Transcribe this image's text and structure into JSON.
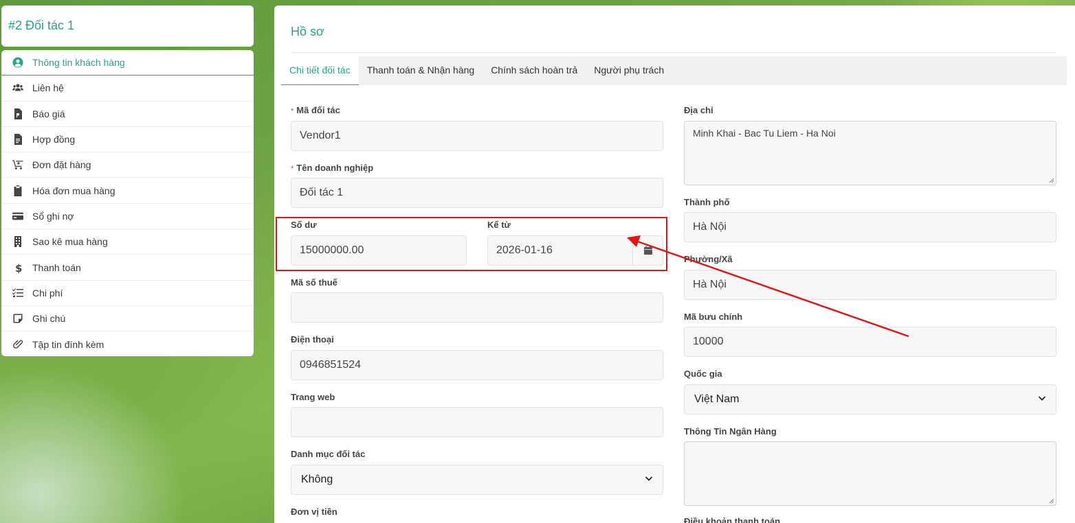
{
  "left": {
    "title": "#2 Đối tác 1",
    "menu": [
      {
        "label": "Thông tin khách hàng",
        "icon": "user-circle-icon",
        "active": true
      },
      {
        "label": "Liên hệ",
        "icon": "users-icon"
      },
      {
        "label": "Báo giá",
        "icon": "file-invoice-icon"
      },
      {
        "label": "Hợp đồng",
        "icon": "file-text-icon"
      },
      {
        "label": "Đơn đặt hàng",
        "icon": "cart-plus-icon"
      },
      {
        "label": "Hóa đơn mua hàng",
        "icon": "clipboard-icon"
      },
      {
        "label": "Sổ ghi nợ",
        "icon": "credit-card-icon"
      },
      {
        "label": "Sao kê mua hàng",
        "icon": "building-icon"
      },
      {
        "label": "Thanh toán",
        "icon": "dollar-icon"
      },
      {
        "label": "Chi phí",
        "icon": "checklist-icon"
      },
      {
        "label": "Ghi chú",
        "icon": "sticky-note-icon"
      },
      {
        "label": "Tập tin đính kèm",
        "icon": "paperclip-icon"
      }
    ]
  },
  "panel": {
    "title": "Hồ sơ",
    "tabs": [
      {
        "label": "Chi tiết đối tác",
        "active": true
      },
      {
        "label": "Thanh toán & Nhận hàng"
      },
      {
        "label": "Chính sách hoàn trả"
      },
      {
        "label": "Người phụ trách"
      }
    ]
  },
  "form": {
    "partner_code": {
      "label": "Mã đối tác",
      "required_mark": "*",
      "value": "Vendor1"
    },
    "company_name": {
      "label": "Tên doanh nghiệp",
      "required_mark": "*",
      "value": "Đối tác 1"
    },
    "balance": {
      "label": "Số dư",
      "value": "15000000.00"
    },
    "since": {
      "label": "Kể từ",
      "value": "2026-01-16"
    },
    "tax_code": {
      "label": "Mã số thuế",
      "value": ""
    },
    "phone": {
      "label": "Điện thoại",
      "value": "0946851524"
    },
    "website": {
      "label": "Trang web",
      "value": ""
    },
    "category": {
      "label": "Danh mục đối tác",
      "value": "Không"
    },
    "currency": {
      "label": "Đơn vị tiền"
    },
    "address": {
      "label": "Địa chỉ",
      "value": "Minh Khai - Bac Tu Liem - Ha Noi"
    },
    "city": {
      "label": "Thành phố",
      "value": "Hà Nội"
    },
    "ward": {
      "label": "Phường/Xã",
      "value": "Hà Nội"
    },
    "postal_code": {
      "label": "Mã bưu chính",
      "value": "10000"
    },
    "country": {
      "label": "Quốc gia",
      "value": "Việt Nam"
    },
    "bank_info": {
      "label": "Thông Tin Ngân Hàng",
      "value": ""
    },
    "payment_terms": {
      "label": "Điều khoản thanh toán"
    }
  },
  "colors": {
    "accent": "#27a38a",
    "annotation": "#e01616"
  }
}
